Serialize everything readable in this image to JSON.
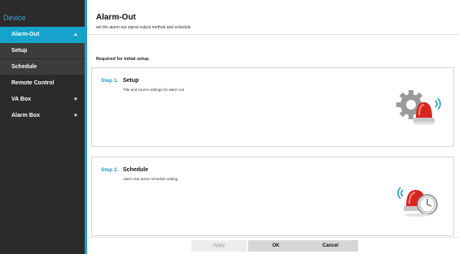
{
  "sidebar": {
    "title": "Device",
    "items": [
      {
        "label": "Alarm-Out",
        "arrow": "▲"
      },
      {
        "label": "Setup",
        "arrow": ""
      },
      {
        "label": "Schedule",
        "arrow": ""
      },
      {
        "label": "Remote Control",
        "arrow": ""
      },
      {
        "label": "VA Box",
        "arrow": "▼"
      },
      {
        "label": "Alarm Box",
        "arrow": "▼"
      }
    ]
  },
  "header": {
    "title": "Alarm-Out",
    "subtitle": "set the alarm-out signal output method and schedule"
  },
  "section": {
    "required_label": "Required for initial setup"
  },
  "steps": [
    {
      "step": "Step 1.",
      "name": "Setup",
      "desc": "Title and source settings for alarm out",
      "icon": "gear-alarm-icon"
    },
    {
      "step": "Step 2.",
      "name": "Schedule",
      "desc": "Alarm Out action schedule setting",
      "icon": "alarm-clock-icon"
    }
  ],
  "footer": {
    "apply": "Apply",
    "ok": "OK",
    "cancel": "Cancel"
  },
  "colors": {
    "accent": "#1fa0c7",
    "sidebar_bg": "#2b2b2b",
    "alarm_red": "#d8261f"
  }
}
